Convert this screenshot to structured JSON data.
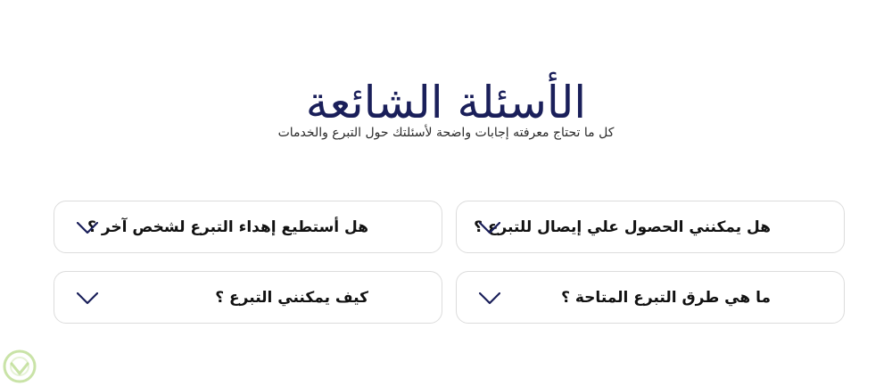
{
  "faq": {
    "title": "الأسئلة الشائعة",
    "subtitle": "كل ما تحتاج معرفته إجابات واضحة لأسئلتك حول التبرع والخدمات",
    "items": [
      {
        "question": "هل يمكنني الحصول علي إيصال للتبرع ؟",
        "icon": "chevron-down-icon"
      },
      {
        "question": "هل أستطيع إهداء التبرع لشخص آخر ؟",
        "icon": "chevron-down-icon"
      },
      {
        "question": "ما هي طرق التبرع المتاحة ؟",
        "icon": "chevron-down-icon"
      },
      {
        "question": "كيف يمكنني التبرع ؟",
        "icon": "chevron-down-icon"
      }
    ]
  },
  "colors": {
    "title": "#1a1f5a",
    "chevron": "#1a1f5a",
    "border": "#dcdcdc",
    "badge": "#b7d98a"
  }
}
